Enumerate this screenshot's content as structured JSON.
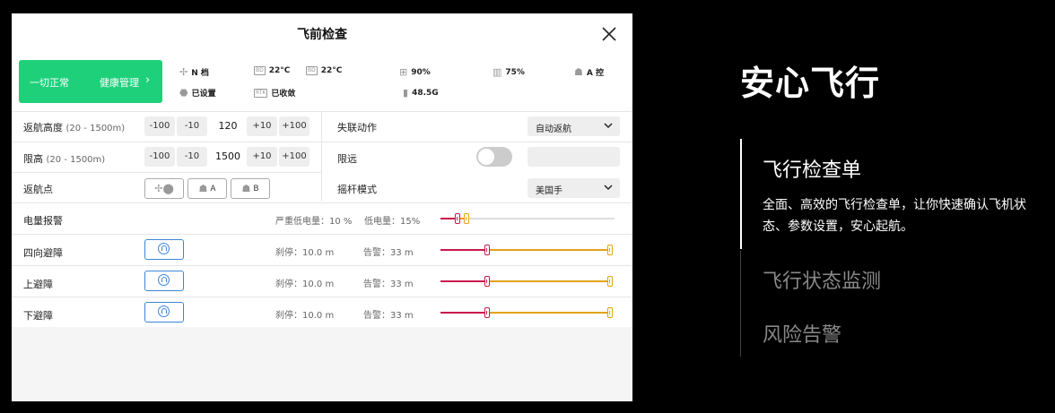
{
  "panel": {
    "title": "飞前检查",
    "status": {
      "label": "一切正常",
      "link": "健康管理",
      "chevron": "›"
    },
    "info": {
      "gear": "N 档",
      "home": "已设置",
      "bat_left_icon": "BD",
      "bat_left_temp": "22°C",
      "bat_right_icon": "BD",
      "bat_right_temp": "22°C",
      "rtk_icon": "RTK",
      "rtk_status": "已收敛",
      "rc_signal": "90%",
      "storage": "48.5G",
      "rc_battery": "75%",
      "control": "A 控"
    },
    "rth_height": {
      "label": "返航高度",
      "range": "(20 - 1500m)",
      "btns": [
        "-100",
        "-10",
        "+10",
        "+100"
      ],
      "value": "120"
    },
    "height_limit": {
      "label": "限高",
      "range": "(20 - 1500m)",
      "btns": [
        "-100",
        "-10",
        "+10",
        "+100"
      ],
      "value": "1500"
    },
    "home_point": {
      "label": "返航点",
      "btn_a": "A",
      "btn_b": "B"
    },
    "lost_action": {
      "label": "失联动作",
      "value": "自动返航"
    },
    "distance_limit": {
      "label": "限远",
      "enabled": false
    },
    "stick_mode": {
      "label": "摇杆模式",
      "value": "美国手"
    },
    "battery_warning": {
      "label": "电量报警",
      "critical": "严重低电量：10 %",
      "low": "低电量：15%",
      "critical_level": 10,
      "low_level": 15
    },
    "obstacles": [
      {
        "label": "四向避障",
        "brake": "刹停：10.0 m",
        "warn": "告警：33 m"
      },
      {
        "label": "上避障",
        "brake": "刹停：10.0 m",
        "warn": "告警：33 m"
      },
      {
        "label": "下避障",
        "brake": "刹停：10.0 m",
        "warn": "告警：33 m"
      }
    ]
  },
  "right": {
    "title": "安心飞行",
    "active_item": "飞行检查单",
    "active_desc": "全面、高效的飞行检查单，让你快速确认飞机状态、参数设置，安心起航。",
    "items": [
      "飞行状态监测",
      "风险告警"
    ]
  },
  "colors": {
    "accent_green": "#1ed07a",
    "accent_blue": "#3d86d8",
    "brake_red": "#c8184c",
    "warn_orange": "#e3a21a"
  }
}
